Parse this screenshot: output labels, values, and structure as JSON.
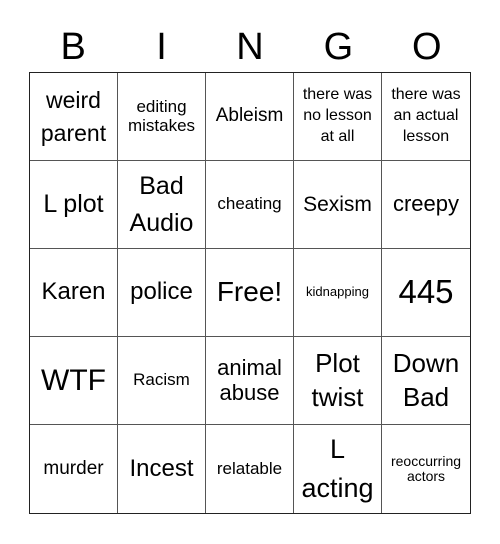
{
  "header": {
    "letters": [
      "B",
      "I",
      "N",
      "G",
      "O"
    ]
  },
  "cells": [
    "weird parent",
    "editing mistakes",
    "Ableism",
    "there was no lesson at all",
    "there was an actual lesson",
    "L plot",
    "Bad Audio",
    "cheating",
    "Sexism",
    "creepy",
    "Karen",
    "police",
    "Free!",
    "kidnapping",
    "445",
    "WTF",
    "Racism",
    "animal abuse",
    "Plot twist",
    "Down Bad",
    "murder",
    "Incest",
    "relatable",
    "L acting",
    "reoccurring actors"
  ]
}
